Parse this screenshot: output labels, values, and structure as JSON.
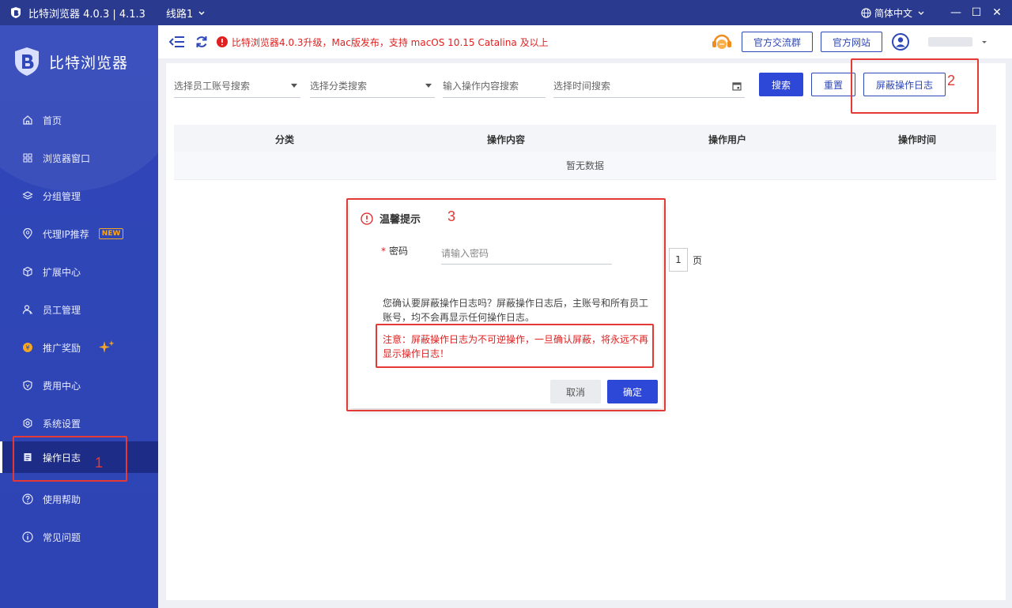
{
  "titlebar": {
    "title": "比特浏览器 4.0.3 | 4.1.3",
    "line": "线路1",
    "language": "简体中文",
    "minimize": "—",
    "maximize": "☐",
    "close": "✕"
  },
  "sidebar": {
    "brand": "比特浏览器",
    "new_badge": "NEW",
    "items": [
      {
        "label": "首页",
        "icon": "home-icon"
      },
      {
        "label": "浏览器窗口",
        "icon": "grid-icon"
      },
      {
        "label": "分组管理",
        "icon": "layers-icon"
      },
      {
        "label": "代理IP推荐",
        "icon": "location-icon"
      },
      {
        "label": "扩展中心",
        "icon": "cube-icon"
      },
      {
        "label": "员工管理",
        "icon": "users-icon"
      },
      {
        "label": "推广奖励",
        "icon": "reward-icon"
      },
      {
        "label": "费用中心",
        "icon": "shield-icon"
      },
      {
        "label": "系统设置",
        "icon": "gear-icon"
      },
      {
        "label": "操作日志",
        "icon": "log-icon"
      },
      {
        "label": "使用帮助",
        "icon": "help-icon"
      },
      {
        "label": "常见问题",
        "icon": "info-icon"
      }
    ]
  },
  "topbar": {
    "notice": "比特浏览器4.0.3升级，Mac版发布，支持 macOS 10.15 Catalina 及以上",
    "group_btn": "官方交流群",
    "site_btn": "官方网站"
  },
  "filters": {
    "staff": "选择员工账号搜索",
    "category": "选择分类搜索",
    "content": "输入操作内容搜索",
    "time": "选择时间搜索",
    "search_btn": "搜索",
    "reset_btn": "重置",
    "shield_btn": "屏蔽操作日志"
  },
  "table": {
    "headers": [
      "分类",
      "操作内容",
      "操作用户",
      "操作时间"
    ],
    "empty": "暂无数据"
  },
  "pager": {
    "page": "1",
    "suffix": "页"
  },
  "dialog": {
    "title": "温馨提示",
    "field_label": "密码",
    "placeholder": "请输入密码",
    "text": "您确认要屏蔽操作日志吗？屏蔽操作日志后，主账号和所有员工账号，均不会再显示任何操作日志。",
    "warning": "注意：屏蔽操作日志为不可逆操作，一旦确认屏蔽，将永远不再显示操作日志！",
    "cancel": "取消",
    "ok": "确定"
  },
  "annotations": [
    "1",
    "2",
    "3"
  ],
  "colors": {
    "sidebar": "#2e44b4",
    "accent": "#2d47d6",
    "warning": "#e02020",
    "annotation": "#e53935"
  }
}
